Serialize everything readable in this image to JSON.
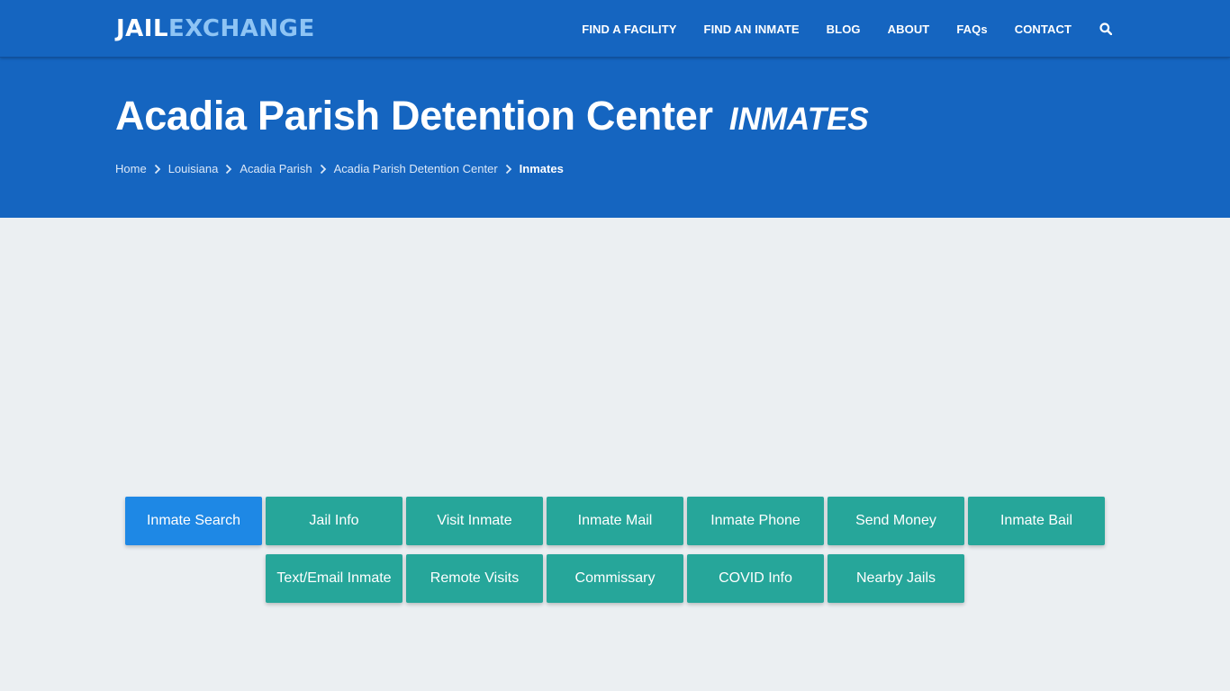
{
  "brand": {
    "part1": "JAIL",
    "part2": "EXCHANGE"
  },
  "nav": {
    "items": [
      {
        "label": "FIND A FACILITY"
      },
      {
        "label": "FIND AN INMATE"
      },
      {
        "label": "BLOG"
      },
      {
        "label": "ABOUT"
      },
      {
        "label": "FAQs"
      },
      {
        "label": "CONTACT"
      }
    ],
    "search_icon": "search-icon"
  },
  "hero": {
    "title": "Acadia Parish Detention Center",
    "subtitle": "INMATES"
  },
  "breadcrumb": {
    "items": [
      {
        "label": "Home"
      },
      {
        "label": "Louisiana"
      },
      {
        "label": "Acadia Parish"
      },
      {
        "label": "Acadia Parish Detention Center"
      },
      {
        "label": "Inmates"
      }
    ],
    "separator_icon": "chevron-right-icon"
  },
  "buttons": {
    "row1": [
      {
        "label": "Inmate Search"
      },
      {
        "label": "Jail Info"
      },
      {
        "label": "Visit Inmate"
      },
      {
        "label": "Inmate Mail"
      },
      {
        "label": "Inmate Phone"
      },
      {
        "label": "Send Money"
      },
      {
        "label": "Inmate Bail"
      }
    ],
    "row2": [
      {
        "label": "Text/Email Inmate"
      },
      {
        "label": "Remote Visits"
      },
      {
        "label": "Commissary"
      },
      {
        "label": "COVID Info"
      },
      {
        "label": "Nearby Jails"
      }
    ],
    "active": "Inmate Search"
  },
  "colors": {
    "header_bg": "#1565c0",
    "logo_accent": "#8ec4f4",
    "button_teal": "#26a69a",
    "button_active": "#1e88e5",
    "page_bg": "#ebeff2"
  }
}
